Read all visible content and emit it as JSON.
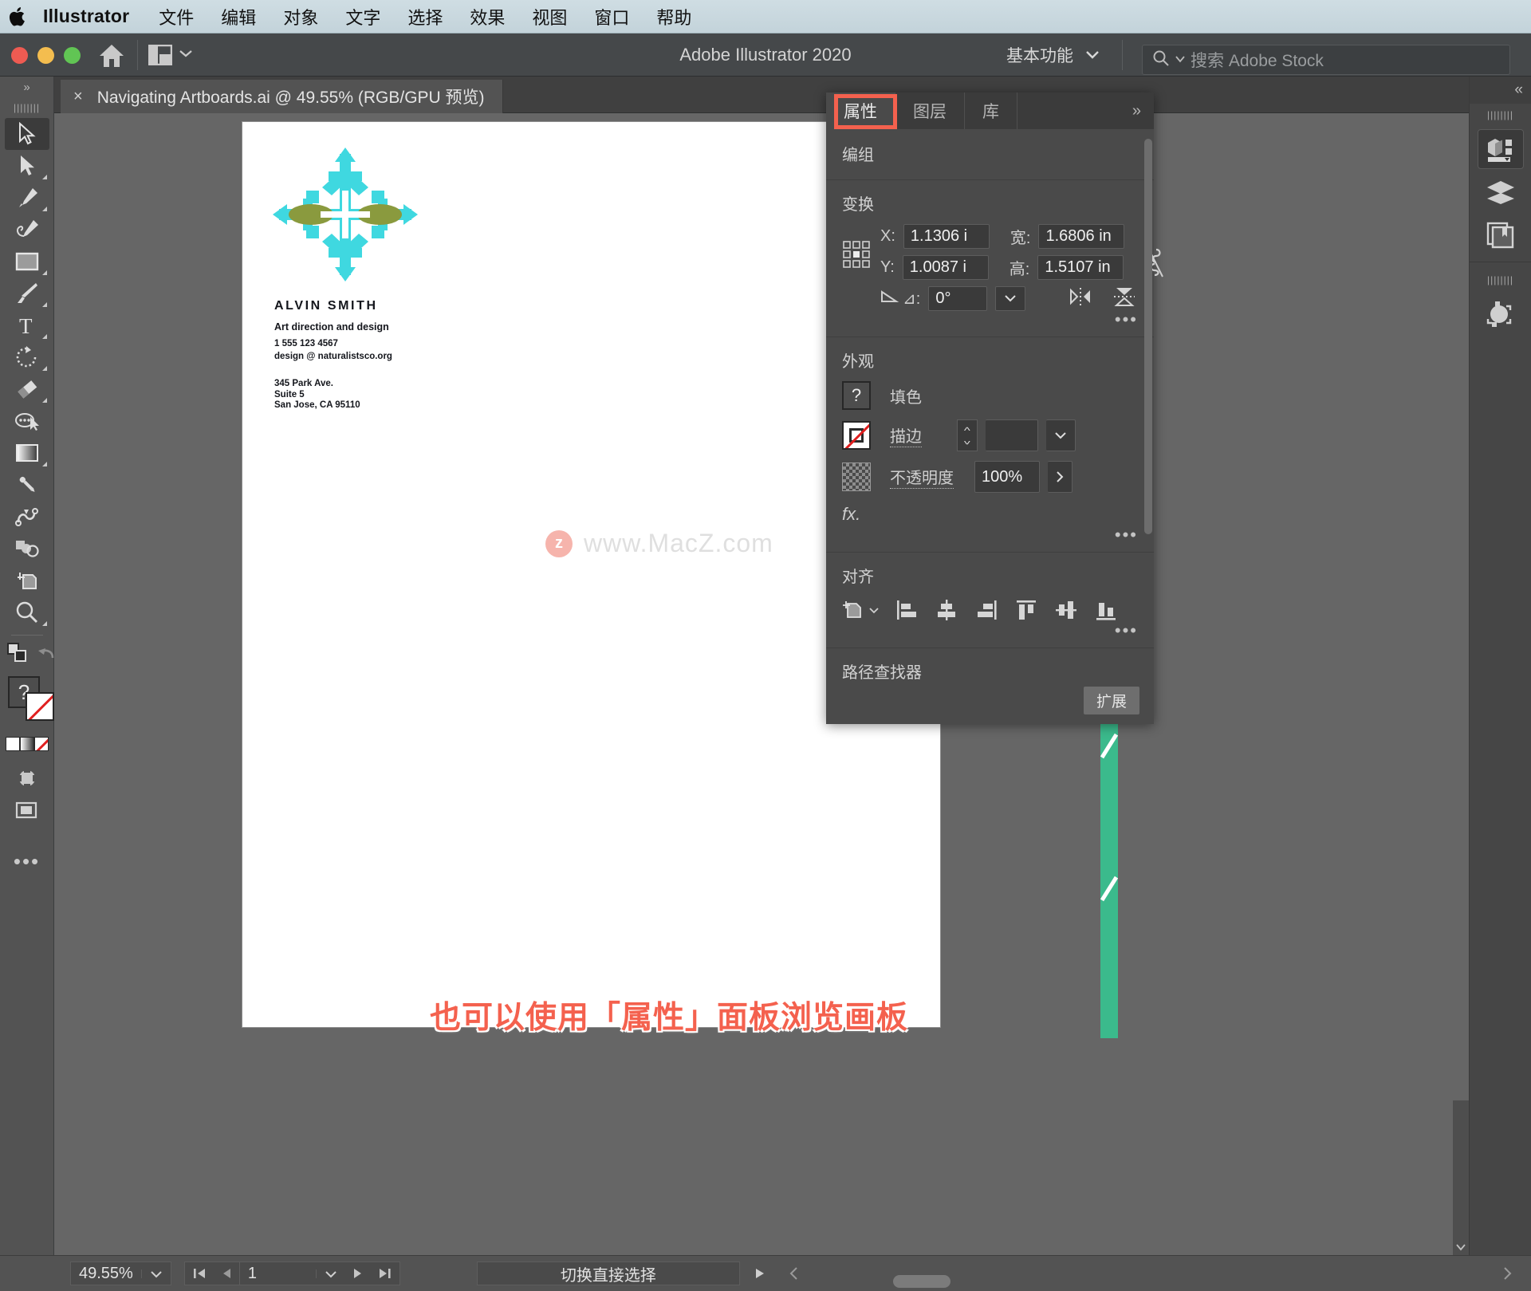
{
  "macmenu": {
    "apple_icon": "apple-logo-icon",
    "app": "Illustrator",
    "items": [
      "文件",
      "编辑",
      "对象",
      "文字",
      "选择",
      "效果",
      "视图",
      "窗口",
      "帮助"
    ]
  },
  "titlebar": {
    "title": "Adobe Illustrator 2020",
    "home_icon": "home-icon",
    "arrange_icon": "arrange-documents-icon",
    "arrange_chevron": "chevron-down-icon",
    "workspace": "基本功能",
    "workspace_chevron": "chevron-down-icon",
    "search_icon": "search-icon",
    "search_chevron": "chevron-down-icon",
    "search_placeholder": "搜索 Adobe Stock",
    "search_value": ""
  },
  "document_tab": {
    "close_label": "×",
    "title": "Navigating Artboards.ai @ 49.55% (RGB/GPU 预览)"
  },
  "toolbar": {
    "grip": "::",
    "tools": [
      {
        "name": "selection-tool",
        "icon": "arrow-cursor-icon",
        "selected": true,
        "has_flyout": false
      },
      {
        "name": "direct-selection-tool",
        "icon": "direct-select-arrow-icon",
        "selected": false,
        "has_flyout": true
      },
      {
        "name": "pen-tool",
        "icon": "pen-nib-icon",
        "selected": false,
        "has_flyout": true
      },
      {
        "name": "curvature-tool",
        "icon": "curvature-pen-icon",
        "selected": false,
        "has_flyout": false
      },
      {
        "name": "rectangle-tool",
        "icon": "rectangle-icon",
        "selected": false,
        "has_flyout": true
      },
      {
        "name": "paintbrush-tool",
        "icon": "paintbrush-icon",
        "selected": false,
        "has_flyout": true
      },
      {
        "name": "type-tool",
        "icon": "type-t-icon",
        "selected": false,
        "has_flyout": true
      },
      {
        "name": "rotate-tool",
        "icon": "rotate-arrow-icon",
        "selected": false,
        "has_flyout": true
      },
      {
        "name": "eraser-tool",
        "icon": "eraser-icon",
        "selected": false,
        "has_flyout": true
      },
      {
        "name": "shape-builder-tool",
        "icon": "shape-builder-icon",
        "selected": false,
        "has_flyout": false
      },
      {
        "name": "gradient-tool",
        "icon": "gradient-swatch-icon",
        "selected": false,
        "has_flyout": true
      },
      {
        "name": "eyedropper-tool",
        "icon": "eyedropper-icon",
        "selected": false,
        "has_flyout": false
      },
      {
        "name": "blend-tool",
        "icon": "blend-squiggle-icon",
        "selected": false,
        "has_flyout": false
      },
      {
        "name": "symbol-sprayer-tool",
        "icon": "symbol-shapes-icon",
        "selected": false,
        "has_flyout": false
      },
      {
        "name": "artboard-tool",
        "icon": "artboard-icon",
        "selected": false,
        "has_flyout": false
      },
      {
        "name": "zoom-tool",
        "icon": "magnifier-icon",
        "selected": false,
        "has_flyout": true
      }
    ],
    "swap_icon": "swap-fill-stroke-icon",
    "reset_icon": "default-colors-icon",
    "fill_icon": "fill-question-icon",
    "stroke_icon": "stroke-none-icon",
    "color_modes_icon": "color-mode-row-icon",
    "screen_mode_icon": "screen-mode-icon",
    "draw_mode_icon": "drawing-mode-icon",
    "more_icon": "more-tools-icon"
  },
  "artboard": {
    "logo_icon": "snowflake-ornament-icon",
    "card": {
      "name": "ALVIN SMITH",
      "role": "Art direction and design",
      "phone": "1 555 123 4567",
      "email": "design @ naturalistsco.org",
      "address_line1": "345 Park Ave.",
      "address_line2": "Suite 5",
      "address_line3": "San Jose, CA 95110"
    },
    "watermark": {
      "badge": "z",
      "text": "www.MacZ.com"
    },
    "annotation": "也可以使用「属性」面板浏览画板"
  },
  "properties_panel": {
    "tabs": [
      {
        "label": "属性",
        "active": true,
        "highlighted": true
      },
      {
        "label": "图层",
        "active": false,
        "highlighted": false
      },
      {
        "label": "库",
        "active": false,
        "highlighted": false
      }
    ],
    "collapse_icon": "double-chevron-right-icon",
    "object_type": "编组",
    "transform": {
      "heading": "变换",
      "reference_point_icon": "reference-point-grid-icon",
      "x_label": "X:",
      "x_value": "1.1306 i",
      "y_label": "Y:",
      "y_value": "1.0087 i",
      "w_label": "宽:",
      "w_value": "1.6806 in",
      "h_label": "高:",
      "h_value": "1.5107 in",
      "link_icon": "unlink-proportions-icon",
      "angle_icon": "shear-angle-icon",
      "angle_label": "⊿:",
      "angle_value": "0°",
      "angle_chevron": "chevron-down-icon",
      "flip_h_icon": "flip-horizontal-icon",
      "flip_v_icon": "flip-vertical-icon",
      "more_icon": "more-options-icon"
    },
    "appearance": {
      "heading": "外观",
      "fill_icon": "fill-question-icon",
      "fill_label": "填色",
      "stroke_icon": "stroke-none-icon",
      "stroke_label": "描边",
      "stroke_weight_value": "",
      "stroke_stepper_icon": "stepper-up-down-icon",
      "stroke_chevron": "chevron-down-icon",
      "opacity_icon": "opacity-checker-icon",
      "opacity_label": "不透明度",
      "opacity_value": "100%",
      "opacity_arrow": "chevron-right-icon",
      "fx_label": "fx.",
      "more_icon": "more-options-icon"
    },
    "align": {
      "heading": "对齐",
      "target_icon": "align-to-artboard-icon",
      "target_chevron": "chevron-down-icon",
      "buttons": [
        {
          "name": "align-left-icon"
        },
        {
          "name": "align-horizontal-center-icon"
        },
        {
          "name": "align-right-icon"
        },
        {
          "name": "align-top-icon"
        },
        {
          "name": "align-vertical-center-icon"
        },
        {
          "name": "align-bottom-icon"
        }
      ],
      "more_icon": "more-options-icon"
    },
    "pathfinder": {
      "heading": "路径查找器",
      "expand_label": "扩展"
    }
  },
  "right_dock": {
    "collapse_icon": "double-chevron-left-icon",
    "buttons": [
      {
        "name": "properties-dock-icon",
        "selected": true
      },
      {
        "name": "layers-dock-icon",
        "selected": false
      },
      {
        "name": "libraries-dock-icon",
        "selected": false
      },
      {
        "name": "color-guide-dock-icon",
        "selected": false
      }
    ]
  },
  "statusbar": {
    "zoom_value": "49.55%",
    "zoom_chevron": "chevron-down-icon",
    "first_artboard_icon": "first-page-icon",
    "prev_artboard_icon": "prev-page-icon",
    "artboard_value": "1",
    "artboard_chevron": "chevron-down-icon",
    "next_artboard_icon": "next-page-icon",
    "last_artboard_icon": "last-page-icon",
    "status_text": "切换直接选择",
    "status_play_icon": "play-triangle-icon",
    "status_prev_icon": "chevron-left-icon",
    "status_next_icon": "chevron-right-icon"
  }
}
